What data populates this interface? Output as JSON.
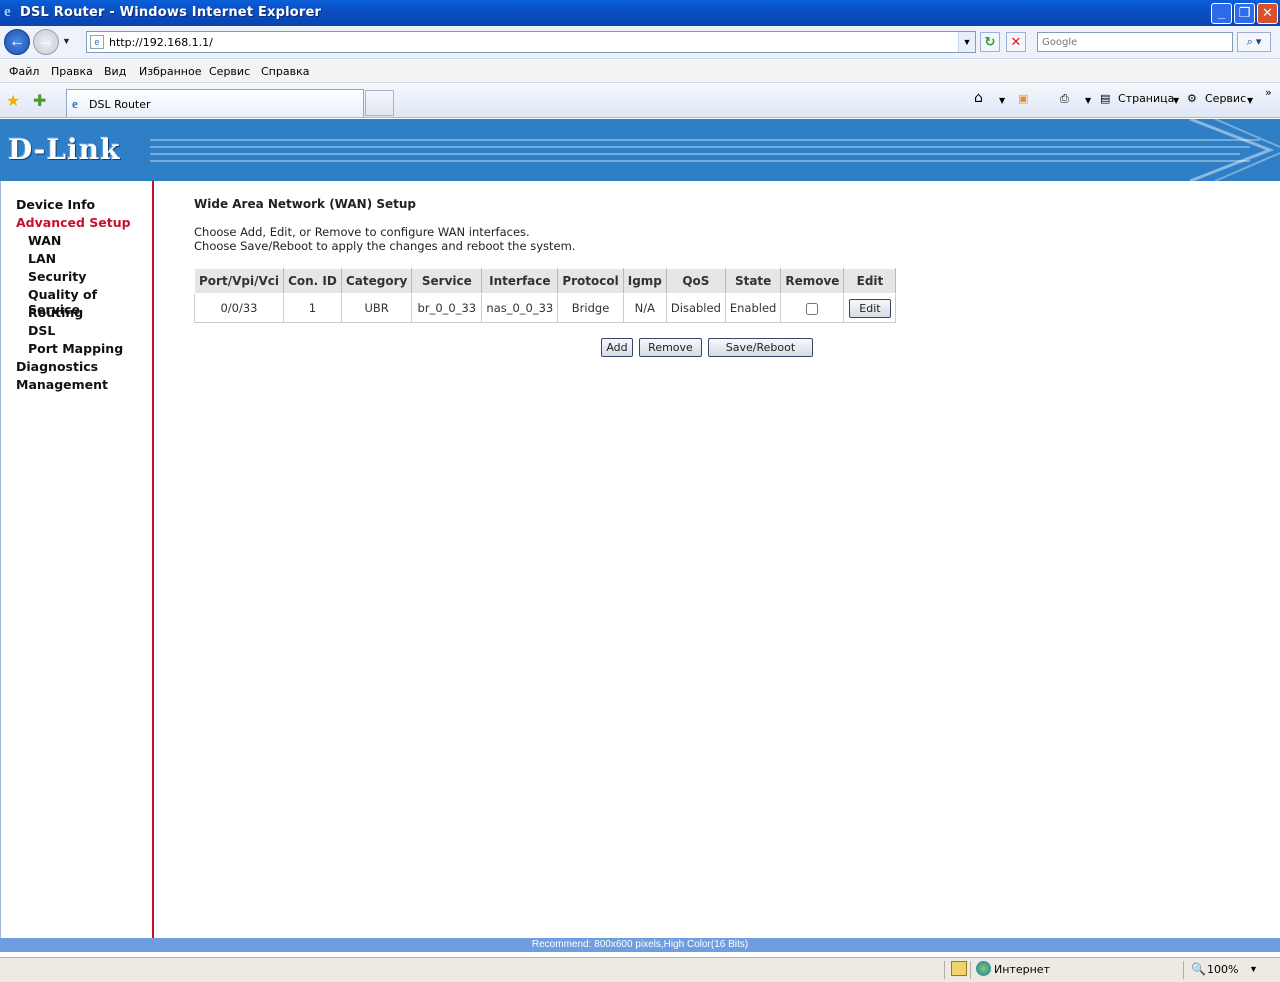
{
  "window": {
    "title": "DSL Router - Windows Internet Explorer"
  },
  "addressbar": {
    "url": "http://192.168.1.1/",
    "search_placeholder": "Google"
  },
  "menubar": {
    "items": [
      "Файл",
      "Правка",
      "Вид",
      "Избранное",
      "Сервис",
      "Справка"
    ]
  },
  "tabs": {
    "active_tab": "DSL Router",
    "page_menu": "Страница",
    "tools_menu": "Сервис"
  },
  "banner": {
    "logo": "D-Link"
  },
  "sidebar": {
    "items": [
      {
        "label": "Device Info",
        "active": false
      },
      {
        "label": "Advanced Setup",
        "active": true
      },
      {
        "label": "WAN",
        "active": false
      },
      {
        "label": "LAN",
        "active": false
      },
      {
        "label": "Security",
        "active": false
      },
      {
        "label": "Quality of Service",
        "active": false
      },
      {
        "label": "Routing",
        "active": false
      },
      {
        "label": "DSL",
        "active": false
      },
      {
        "label": "Port Mapping",
        "active": false
      },
      {
        "label": "Diagnostics",
        "active": false
      },
      {
        "label": "Management",
        "active": false
      }
    ]
  },
  "main": {
    "title": "Wide Area Network (WAN) Setup",
    "line1": "Choose Add, Edit, or Remove to configure WAN interfaces.",
    "line2": "Choose Save/Reboot to apply the changes and reboot the system.",
    "table": {
      "headers": [
        "Port/Vpi/Vci",
        "Con. ID",
        "Category",
        "Service",
        "Interface",
        "Protocol",
        "Igmp",
        "QoS",
        "State",
        "Remove",
        "Edit"
      ],
      "rows": [
        {
          "port_vpi_vci": "0/0/33",
          "con_id": "1",
          "category": "UBR",
          "service": "br_0_0_33",
          "interface": "nas_0_0_33",
          "protocol": "Bridge",
          "igmp": "N/A",
          "qos": "Disabled",
          "state": "Enabled",
          "remove_checked": false,
          "edit_label": "Edit"
        }
      ]
    },
    "buttons": {
      "add": "Add",
      "remove": "Remove",
      "save_reboot": "Save/Reboot"
    }
  },
  "footer": {
    "text": "Recommend: 800x600 pixels,High Color(16 Bits)"
  },
  "statusbar": {
    "zone": "Интернет",
    "zoom": "100%"
  },
  "colors": {
    "banner": "#2f7fc6",
    "active_nav": "#c8102e",
    "sidebar_border": "#c8102e",
    "footer_bar": "#6f9ee0"
  }
}
